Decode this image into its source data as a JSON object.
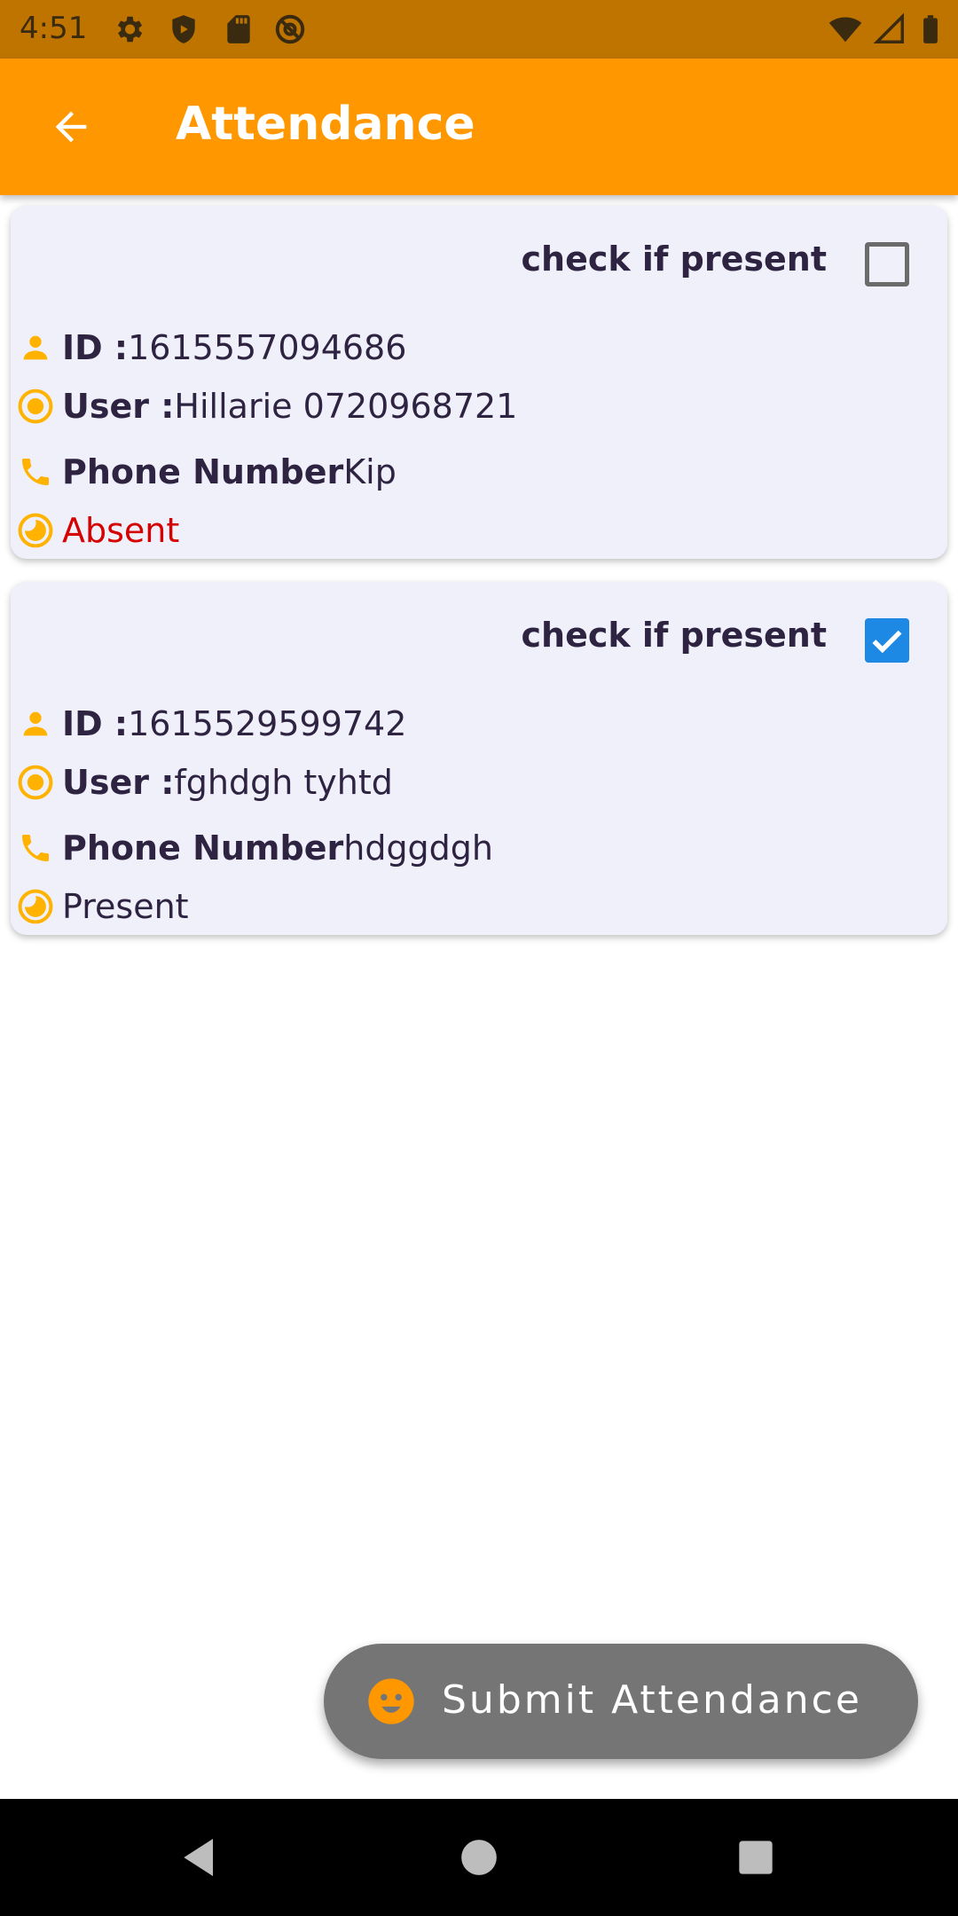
{
  "status_bar": {
    "time": "4:51",
    "icons": [
      "settings-icon",
      "shield-icon",
      "sd-card-icon",
      "at-sign-icon",
      "wifi-icon",
      "signal-icon",
      "battery-icon"
    ]
  },
  "app_bar": {
    "title": "Attendance",
    "back_icon": "arrow-back-icon"
  },
  "records": [
    {
      "check_label": "check if present",
      "checked": false,
      "id_label": "ID : ",
      "id_value": "1615557094686",
      "user_label": "User : ",
      "user_value": "Hillarie 0720968721",
      "phone_label": "Phone Number",
      "phone_value": "Kip",
      "status": "Absent"
    },
    {
      "check_label": "check if present",
      "checked": true,
      "id_label": "ID : ",
      "id_value": "1615529599742",
      "user_label": "User : ",
      "user_value": "fghdgh tyhtd",
      "phone_label": "Phone Number",
      "phone_value": "hdggdgh",
      "status": "Present"
    }
  ],
  "fab": {
    "label": "Submit Attendance",
    "icon": "face-icon"
  },
  "colors": {
    "app_bar": "#ff9800",
    "status_bar": "#bf7400",
    "card_bg": "#f0f0fb",
    "accent_icon": "#ffb300",
    "checkbox_checked": "#1e88e5",
    "absent": "#d50000",
    "text": "#2e2442"
  }
}
